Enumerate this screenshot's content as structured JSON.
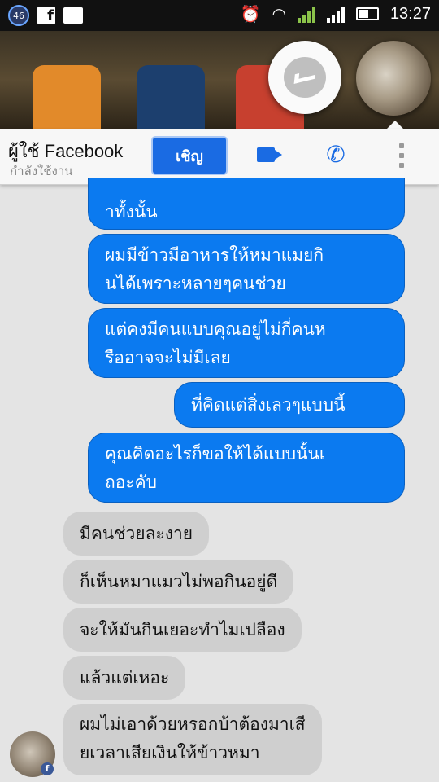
{
  "status_bar": {
    "notification_count": "46",
    "time": "13:27",
    "icons": [
      "notification-badge-icon",
      "facebook-icon",
      "image-icon",
      "alarm-icon",
      "wifi-icon",
      "signal-1-icon",
      "signal-2-icon",
      "battery-icon"
    ]
  },
  "header": {
    "title": "ผู้ใช้ Facebook",
    "subtitle": "กำลังใช้งาน",
    "invite_label": "เชิญ",
    "accent": "#1a6be3"
  },
  "messages": [
    {
      "side": "out",
      "text": "าทั้งนั้น"
    },
    {
      "side": "out",
      "text": "ผมมีข้าวมีอาหารให้หมาแมยกิ\nนได้เพราะหลายๆคนช่วย"
    },
    {
      "side": "out",
      "text": "แต่คงมีคนแบบคุณอยู่ไม่กี่คนห\nรืออาจจะไม่มีเลย"
    },
    {
      "side": "out",
      "text": "ที่คิดแต่สิ่งเลวๆแบบนี้"
    },
    {
      "side": "out",
      "text": "คุณคิดอะไรก็ขอให้ได้แบบนั้นเ\nถอะคับ"
    },
    {
      "side": "in",
      "text": "มีคนช่วยละงาย"
    },
    {
      "side": "in",
      "text": "ก็เห็นหมาแมวไม่พอกินอยู่ดี"
    },
    {
      "side": "in",
      "text": "จะให้มันกินเยอะทำไมเปลือง"
    },
    {
      "side": "in",
      "text": "แล้วแต่เหอะ"
    },
    {
      "side": "in",
      "text": "ผมไม่เอาด้วยหรอกบ้าต้องมาเสี\nยเวลาเสียเงินให้ข้าวหมา"
    }
  ],
  "colors": {
    "outgoing": "#0b7af0",
    "incoming": "#cfcfcf",
    "background": "#e4e4e4"
  }
}
